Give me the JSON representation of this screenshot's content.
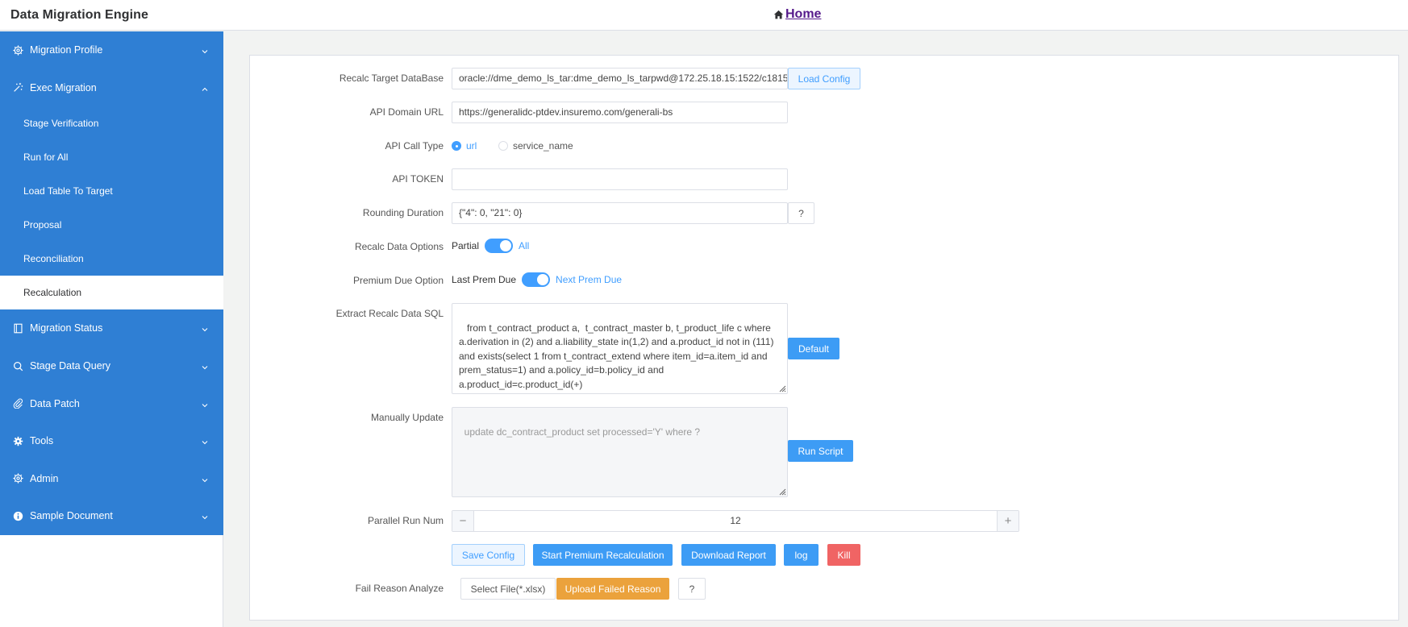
{
  "app": {
    "title": "Data Migration Engine",
    "home_label": "Home"
  },
  "sidebar": {
    "migration_profile": "Migration Profile",
    "exec_migration": "Exec Migration",
    "sub_items": [
      "Stage Verification",
      "Run for All",
      "Load Table To Target",
      "Proposal",
      "Reconciliation",
      "Recalculation"
    ],
    "active_sub_item": "Recalculation",
    "migration_status": "Migration Status",
    "stage_data_query": "Stage Data Query",
    "data_patch": "Data Patch",
    "tools": "Tools",
    "admin": "Admin",
    "sample_document": "Sample Document"
  },
  "form": {
    "target_db": {
      "label": "Recalc Target DataBase",
      "value": "oracle://dme_demo_ls_tar:dme_demo_ls_tarpwd@172.25.18.15:1522/c1815",
      "button": "Load Config"
    },
    "api_domain": {
      "label": "API Domain URL",
      "value": "https://generalidc-ptdev.insuremo.com/generali-bs"
    },
    "api_call_type": {
      "label": "API Call Type",
      "options": [
        "url",
        "service_name"
      ],
      "selected": "url"
    },
    "api_token": {
      "label": "API TOKEN",
      "value": ""
    },
    "rounding": {
      "label": "Rounding Duration",
      "value": "{\"4\": 0, \"21\": 0}",
      "help": "?"
    },
    "recalc_options": {
      "label": "Recalc Data Options",
      "off_text": "Partial",
      "on_text": "All",
      "on": true
    },
    "premium_due": {
      "label": "Premium Due Option",
      "off_text": "Last Prem Due",
      "on_text": "Next Prem Due",
      "on": true
    },
    "extract_sql": {
      "label": "Extract Recalc Data SQL",
      "value": " from t_contract_product a,  t_contract_master b, t_product_life c where a.derivation in (2) and a.liability_state in(1,2) and a.product_id not in (111) and exists(select 1 from t_contract_extend where item_id=a.item_id and prem_status=1) and a.policy_id=b.policy_id and a.product_id=c.product_id(+)",
      "button": "Default"
    },
    "manual_update": {
      "label": "Manually Update",
      "placeholder": "update dc_contract_product set processed='Y' where ?",
      "button": "Run Script"
    },
    "parallel": {
      "label": "Parallel Run Num",
      "value": "12",
      "dec": "−",
      "inc": "+"
    },
    "actions": {
      "save": "Save Config",
      "start": "Start Premium Recalculation",
      "download": "Download Report",
      "log": "log",
      "kill": "Kill"
    },
    "fail_reason": {
      "label": "Fail Reason Analyze",
      "select_file": "Select File(*.xlsx)",
      "upload": "Upload Failed Reason",
      "help": "?"
    }
  },
  "colors": {
    "sidebar_bg": "#2f7fd4",
    "primary": "#3d9cf5",
    "danger": "#f06464",
    "warning": "#eba23c",
    "home_link": "#551a8b"
  },
  "icons": [
    "home-icon",
    "gear-icon",
    "magic-wand-icon",
    "document-icon",
    "search-icon",
    "paperclip-icon",
    "cog-icon",
    "gear-icon",
    "info-icon",
    "chevron-down-icon",
    "chevron-up-icon"
  ]
}
